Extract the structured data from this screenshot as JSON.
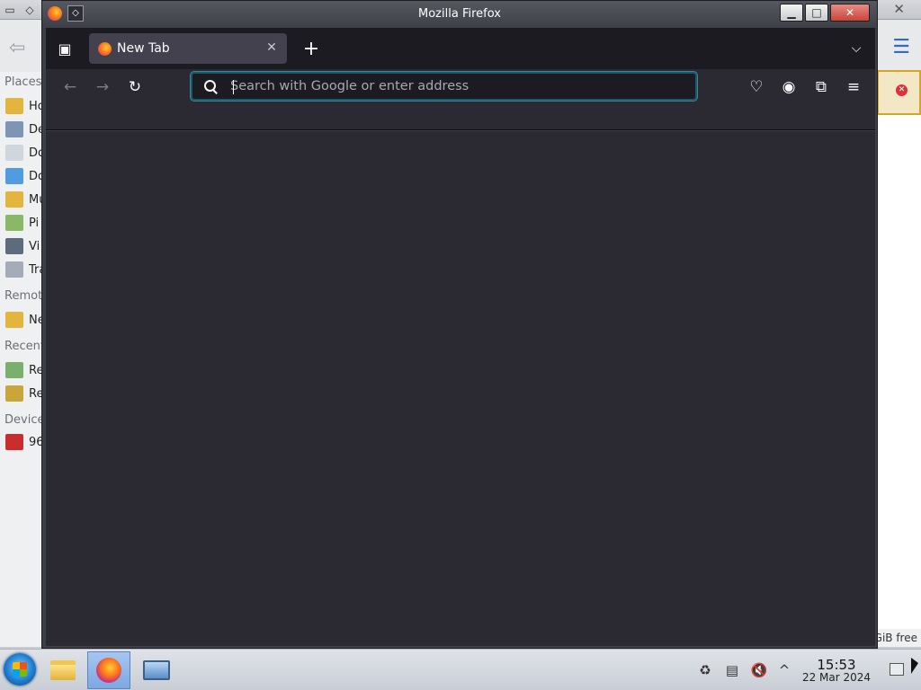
{
  "file_manager": {
    "sidebar_sections": [
      "Places",
      "Remote",
      "Recent",
      "Devices"
    ],
    "sidebar_items": [
      {
        "label": "Ho",
        "color": "#e4b53d"
      },
      {
        "label": "De",
        "color": "#7d96b5"
      },
      {
        "label": "Do",
        "color": "#d0d6de"
      },
      {
        "label": "Do",
        "color": "#4f9de0"
      },
      {
        "label": "Mu",
        "color": "#e4b53d"
      },
      {
        "label": "Pi",
        "color": "#8bb866"
      },
      {
        "label": "Vi",
        "color": "#5d6b7d"
      },
      {
        "label": "Tra",
        "color": "#a3acb7"
      },
      {
        "label": "Ne",
        "color": "#e4b53d"
      },
      {
        "label": "Re",
        "color": "#7ab06b"
      },
      {
        "label": "Re",
        "color": "#c9a63a"
      },
      {
        "label": "96",
        "color": "#c92d2d"
      }
    ],
    "status_text": "GiB free",
    "close_glyph": "✕"
  },
  "firefox": {
    "window_title": "Mozilla Firefox",
    "window_buttons": {
      "minimize": "▁",
      "maximize": "□",
      "close": "✕"
    },
    "tab": {
      "title": "New Tab",
      "close_glyph": "✕"
    },
    "new_tab_glyph": "+",
    "list_all_tabs_glyph": "⌄",
    "nav": {
      "back": "←",
      "forward": "→",
      "reload": "↻"
    },
    "urlbar": {
      "placeholder": "Search with Google or enter address",
      "value": ""
    },
    "toolbar_icons": [
      "pocket-icon",
      "account-icon",
      "extensions-icon",
      "app-menu-icon"
    ],
    "toolbar_glyphs": {
      "pocket": "♡",
      "account": "◉",
      "extensions": "⧉",
      "menu": "≡"
    }
  },
  "taskbar": {
    "clock_time": "15:53",
    "clock_date": "22 Mar 2024",
    "tray_glyphs": {
      "clipboard": "▤",
      "volume": "🔇",
      "expand": "^"
    }
  }
}
